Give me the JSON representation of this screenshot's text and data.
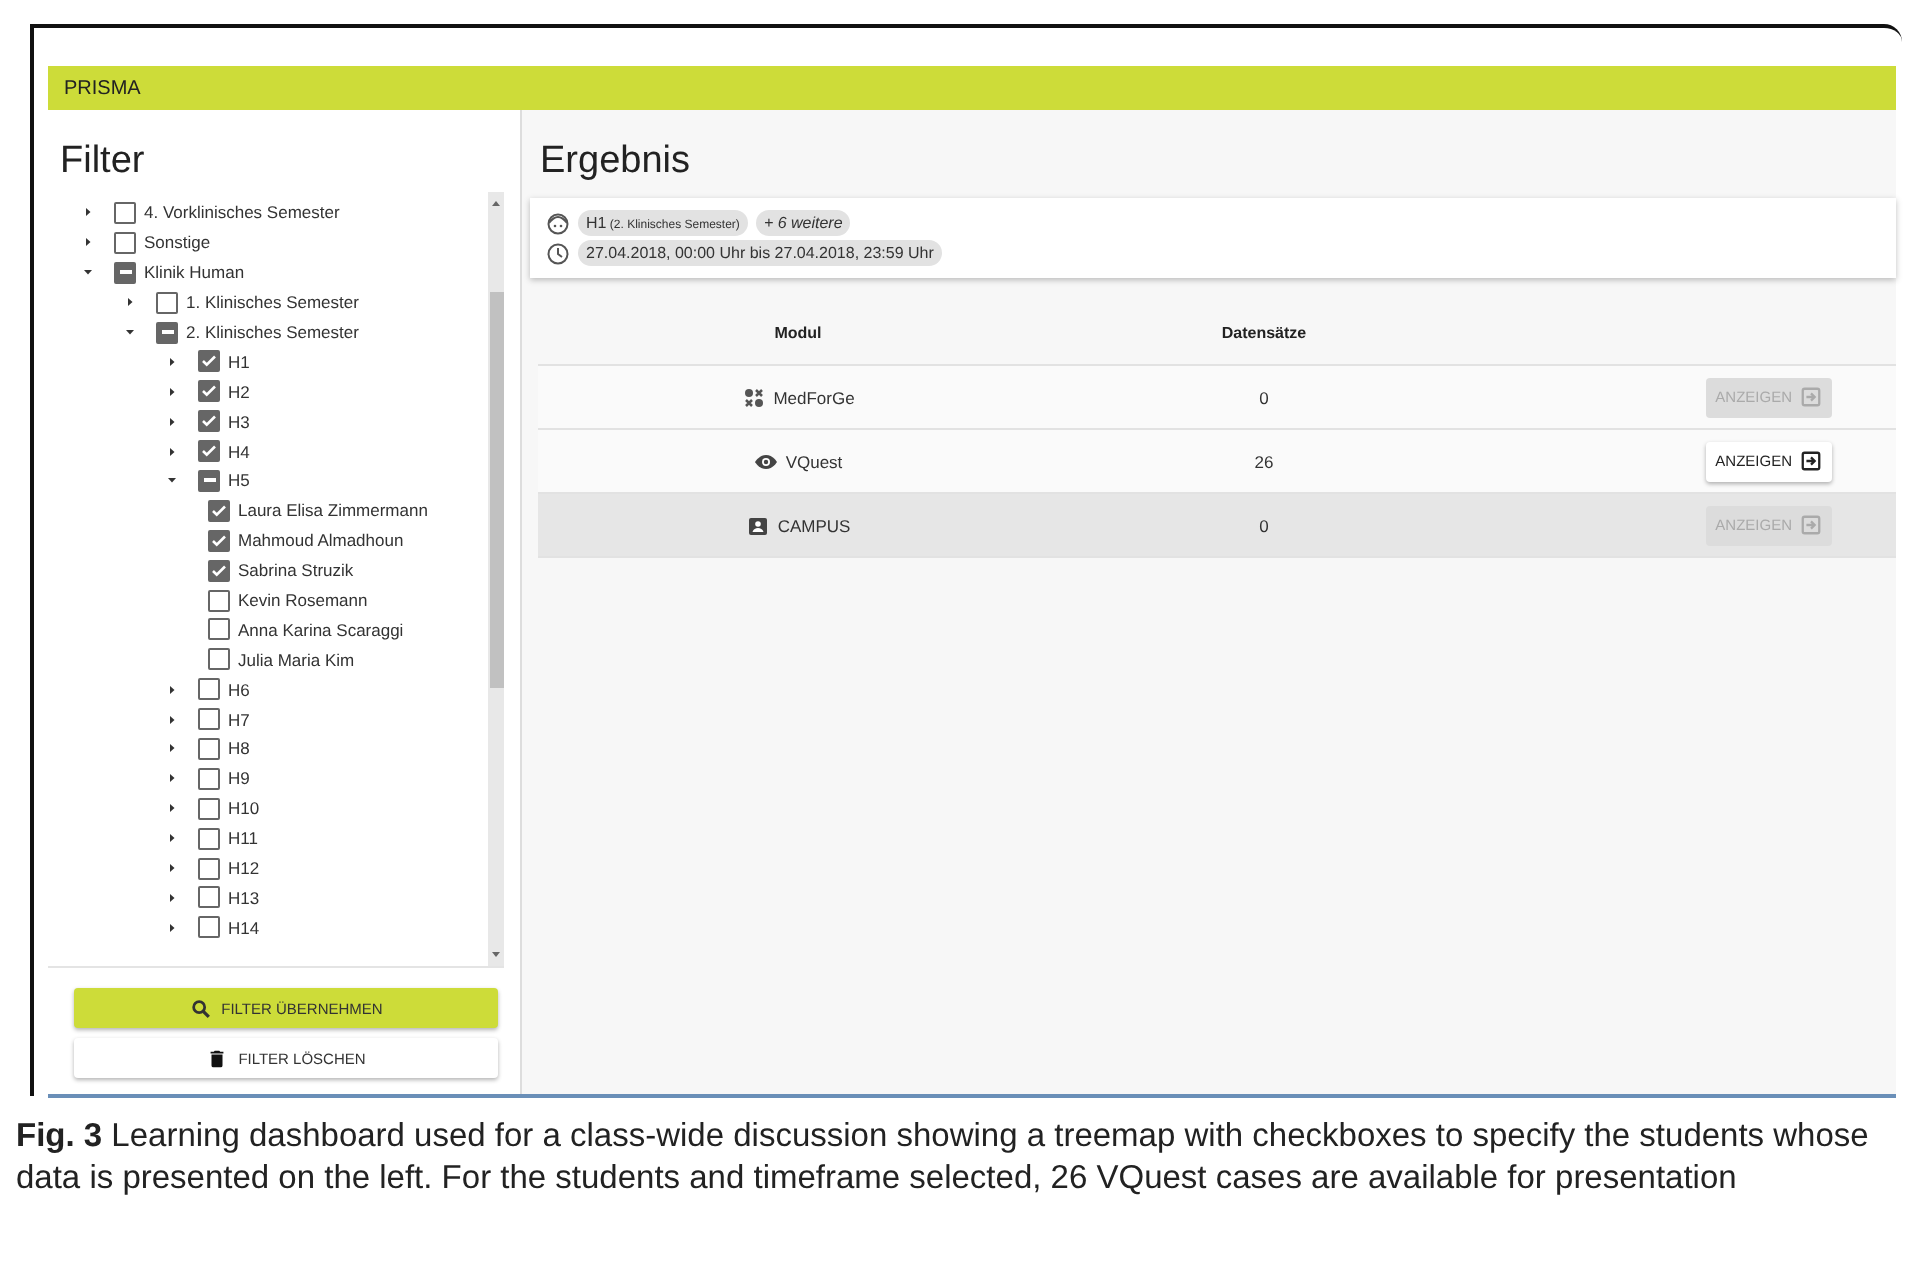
{
  "app": {
    "title": "PRISMA"
  },
  "filter": {
    "heading": "Filter",
    "tree": [
      {
        "children": [
          {
            "label": "4. Vorklinisches Semester",
            "expanded": false,
            "checked": false
          },
          {
            "label": "Sonstige",
            "expanded": false,
            "checked": false
          }
        ]
      },
      {
        "label": "Klinik Human",
        "expanded": true,
        "partial": true,
        "children": [
          {
            "label": "1. Klinisches Semester",
            "expanded": false,
            "checked": false
          },
          {
            "label": "2. Klinisches Semester",
            "expanded": true,
            "partial": true,
            "children": [
              {
                "label": "H1",
                "expanded": false,
                "checked": true
              },
              {
                "label": "H2",
                "expanded": false,
                "checked": true
              },
              {
                "label": "H3",
                "expanded": false,
                "checked": true
              },
              {
                "label": "H4",
                "expanded": false,
                "checked": true
              },
              {
                "label": "H5",
                "expanded": true,
                "partial": true,
                "children": [
                  {
                    "label": "Laura Elisa Zimmermann",
                    "checked": true
                  },
                  {
                    "label": "Mahmoud Almadhoun",
                    "checked": true
                  },
                  {
                    "label": "Sabrina Struzik",
                    "checked": true
                  },
                  {
                    "label": "Kevin Rosemann",
                    "checked": false
                  },
                  {
                    "label": "Anna Karina Scaraggi",
                    "checked": false
                  },
                  {
                    "label": "Julia Maria Kim",
                    "checked": false
                  }
                ]
              },
              {
                "label": "H6",
                "expanded": false,
                "checked": false
              },
              {
                "label": "H7",
                "expanded": false,
                "checked": false
              },
              {
                "label": "H8",
                "expanded": false,
                "checked": false
              },
              {
                "label": "H9",
                "expanded": false,
                "checked": false
              },
              {
                "label": "H10",
                "expanded": false,
                "checked": false
              },
              {
                "label": "H11",
                "expanded": false,
                "checked": false
              },
              {
                "label": "H12",
                "expanded": false,
                "checked": false
              },
              {
                "label": "H13",
                "expanded": false,
                "checked": false
              },
              {
                "label": "H14",
                "expanded": false,
                "checked": false
              }
            ]
          }
        ]
      }
    ],
    "buttons": [
      {
        "kind": "apply",
        "label": "FILTER ÜBERNEHMEN"
      },
      {
        "kind": "clear",
        "label": "FILTER LÖSCHEN"
      }
    ]
  },
  "result": {
    "heading": "Ergebnis",
    "summary": [
      {
        "kind": "group",
        "chips": [
          {
            "label": "H1",
            "note": "(2. Klinisches Semester)"
          },
          {
            "label": "+ 6 weitere",
            "italic": true
          }
        ]
      },
      {
        "kind": "time",
        "chips": [
          {
            "label": "27.04.2018, 00:00 Uhr bis 27.04.2018, 23:59 Uhr"
          }
        ]
      }
    ],
    "table": {
      "columns": [
        "Modul",
        "Datensätze"
      ],
      "rows": [
        {
          "module": "MedForGe",
          "count": "0",
          "action": "ANZEIGEN",
          "disabled": true,
          "shaded": false
        },
        {
          "module": "VQuest",
          "count": "26",
          "action": "ANZEIGEN",
          "disabled": false,
          "shaded": false
        },
        {
          "module": "CAMPUS",
          "count": "0",
          "action": "ANZEIGEN",
          "disabled": true,
          "shaded": true
        }
      ]
    }
  },
  "caption": "**Fig. 3** Learning dashboard used for a class-wide discussion showing a treemap with checkboxes to specify the students whose data is presented on the left. For the students and timeframe selected, 26 VQuest cases are available for presentation"
}
